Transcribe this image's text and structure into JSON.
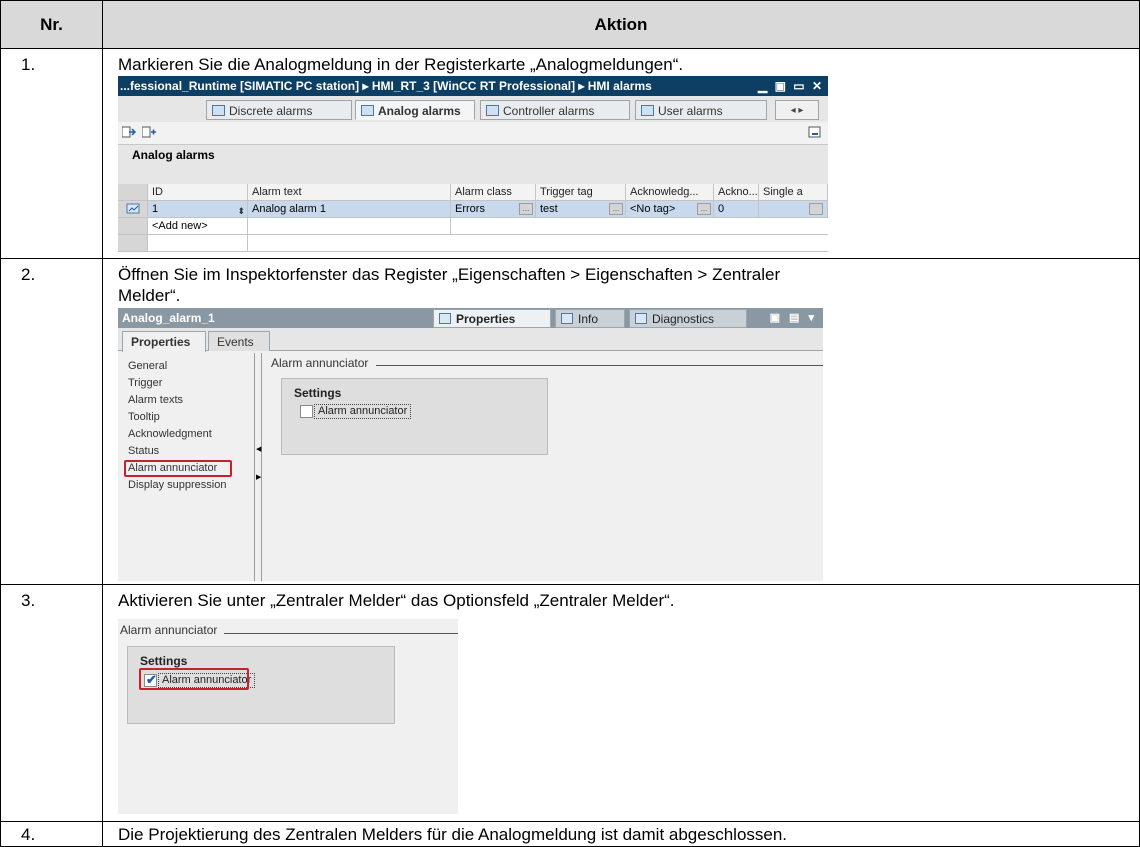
{
  "table": {
    "header_nr": "Nr.",
    "header_aktion": "Aktion"
  },
  "steps": [
    {
      "nr": "1.",
      "text": "Markieren Sie die Analogmeldung in der Registerkarte „Analogmeldungen“."
    },
    {
      "nr": "2.",
      "text": "Öffnen Sie im Inspektorfenster das Register „Eigenschaften > Eigenschaften > Zentraler Melder“."
    },
    {
      "nr": "3.",
      "text": "Aktivieren Sie unter „Zentraler Melder“ das Optionsfeld „Zentraler Melder“."
    },
    {
      "nr": "4.",
      "text": "Die Projektierung des Zentralen Melders für die Analogmeldung ist damit abgeschlossen."
    }
  ],
  "shot1": {
    "title": "...fessional_Runtime [SIMATIC PC station] ▸ HMI_RT_3 [WinCC RT Professional] ▸ HMI alarms",
    "window_controls": "▁ ▣ ▭ ✕",
    "tabs": [
      "Discrete alarms",
      "Analog alarms",
      "Controller alarms",
      "User alarms"
    ],
    "tab_arrows": "◂ ▸",
    "grid_title": "Analog alarms",
    "columns": [
      "ID",
      "Alarm text",
      "Alarm class",
      "Trigger tag",
      "Acknowledg...",
      "Ackno...",
      "Single a"
    ],
    "row": {
      "id": "1",
      "alarm_text": "Analog alarm 1",
      "alarm_class": "Errors",
      "trigger_tag": "test",
      "ack_tag": "<No tag>",
      "ack_value": "0"
    },
    "add_new": "<Add new>"
  },
  "shot2": {
    "object_name": "Analog_alarm_1",
    "top_tabs": [
      "Properties",
      "Info",
      "Diagnostics"
    ],
    "window_controls": "▣ ▤ ▾",
    "tabs": [
      "Properties",
      "Events"
    ],
    "nav_items": [
      "General",
      "Trigger",
      "Alarm texts",
      "Tooltip",
      "Acknowledgment",
      "Status",
      "Alarm annunciator",
      "Display suppression"
    ],
    "section_title": "Alarm annunciator",
    "settings_label": "Settings",
    "checkbox_label": "Alarm annunciator"
  },
  "shot3": {
    "section_title": "Alarm annunciator",
    "settings_label": "Settings",
    "checkbox_label": "Alarm annunciator",
    "checked": true
  }
}
